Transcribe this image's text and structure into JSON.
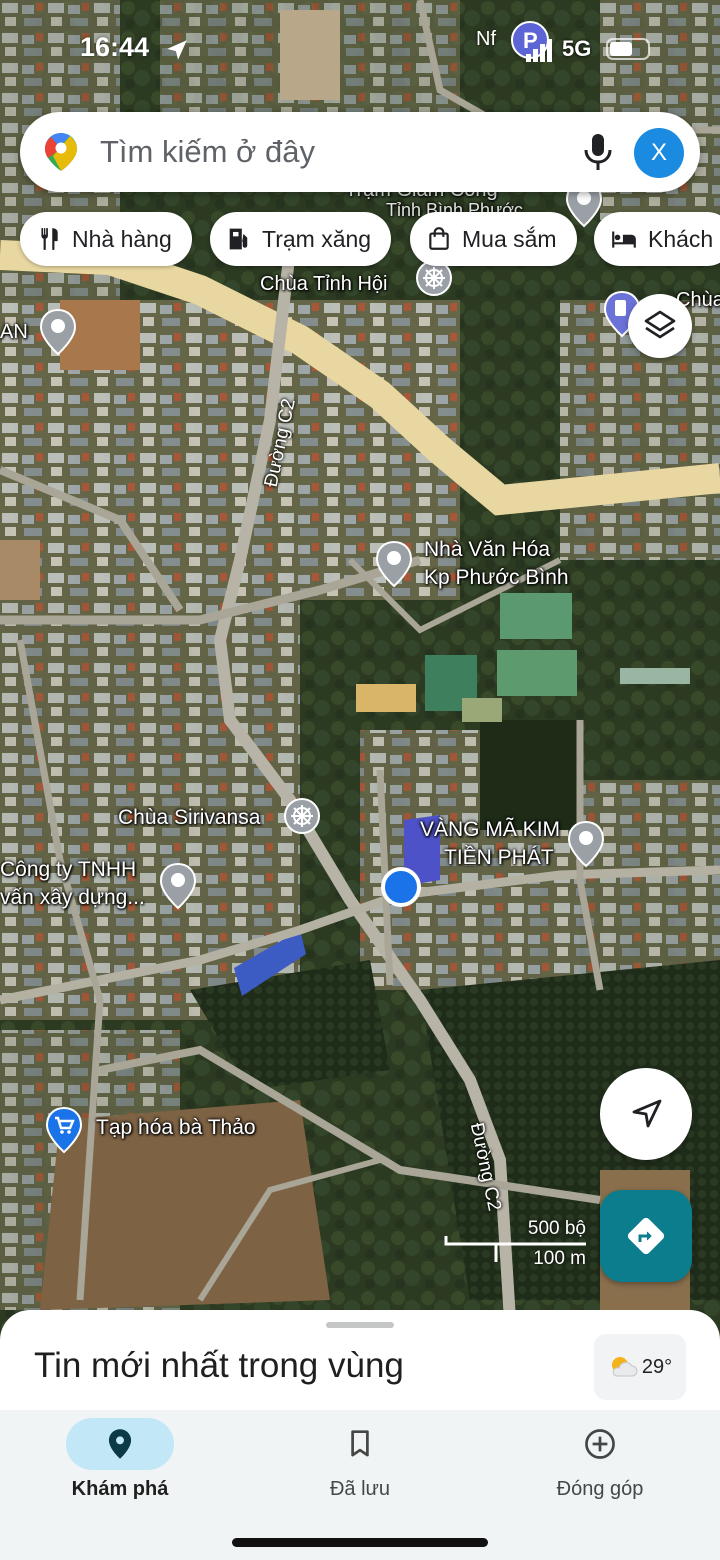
{
  "status_bar": {
    "time": "16:44",
    "carrier_badge": "Nf",
    "network": "5G",
    "location_arrow": "location-arrow-icon"
  },
  "search": {
    "placeholder": "Tìm kiếm ở đây",
    "avatar_letter": "X"
  },
  "chips": [
    {
      "label": "Nhà hàng",
      "icon": "restaurant-icon"
    },
    {
      "label": "Trạm xăng",
      "icon": "gas-station-icon"
    },
    {
      "label": "Mua sắm",
      "icon": "shopping-bag-icon"
    },
    {
      "label": "Khách",
      "icon": "hotel-icon"
    }
  ],
  "map": {
    "places": {
      "top_partial": "Trạm Giám Công",
      "top_partial2": "Tỉnh Bình Phước",
      "chua_tinh_hoi": "Chùa Tỉnh Hội",
      "chua_right": "Chùa",
      "an_left": "AN",
      "nha_van_hoa_1": "Nhà Văn Hóa",
      "nha_van_hoa_2": "Kp Phước Bình",
      "chua_sirivansa": "Chùa Sirivansa",
      "vang_ma_1": "VÀNG MÃ KIM",
      "vang_ma_2": "TIỀN PHÁT",
      "cong_ty_1": "Công ty TNHH",
      "cong_ty_2": "vấn xây dựng...",
      "tap_hoa": "Tạp hóa bà Thảo"
    },
    "roads": {
      "c2_top": "Đường C2",
      "c2_bottom": "Đường C2"
    },
    "scale": {
      "imperial": "500 bộ",
      "metric": "100 m"
    },
    "colors": {
      "road_main": "#e8d7a0",
      "user_dot": "#1a73e8",
      "pin_grey": "#9aa0a6",
      "pin_blue": "#1a73e8"
    }
  },
  "sheet": {
    "title": "Tin mới nhất trong vùng",
    "temperature": "29°"
  },
  "nav": [
    {
      "label": "Khám phá",
      "icon": "explore-pin-icon",
      "active": true
    },
    {
      "label": "Đã lưu",
      "icon": "bookmark-icon",
      "active": false
    },
    {
      "label": "Đóng góp",
      "icon": "add-circle-icon",
      "active": false
    }
  ]
}
